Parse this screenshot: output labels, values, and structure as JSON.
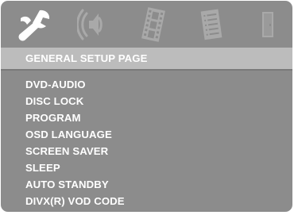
{
  "tabs": [
    {
      "icon": "wrench-icon",
      "name": "general"
    },
    {
      "icon": "speaker-icon",
      "name": "audio"
    },
    {
      "icon": "film-icon",
      "name": "video"
    },
    {
      "icon": "document-list-icon",
      "name": "preference"
    },
    {
      "icon": "door-exit-icon",
      "name": "exit"
    }
  ],
  "page": {
    "title": "GENERAL SETUP PAGE"
  },
  "menu": {
    "items": [
      "DVD-AUDIO",
      "DISC LOCK",
      "PROGRAM",
      "OSD LANGUAGE",
      "SCREEN SAVER",
      "SLEEP",
      "AUTO STANDBY",
      "DIVX(R) VOD CODE"
    ]
  },
  "colors": {
    "screen_background": "#8c8c8c",
    "selected_row": "#bcbcbc",
    "active_icon": "#ffffff",
    "inactive_icon": "#a9a9a9",
    "text": "#ffffff"
  }
}
